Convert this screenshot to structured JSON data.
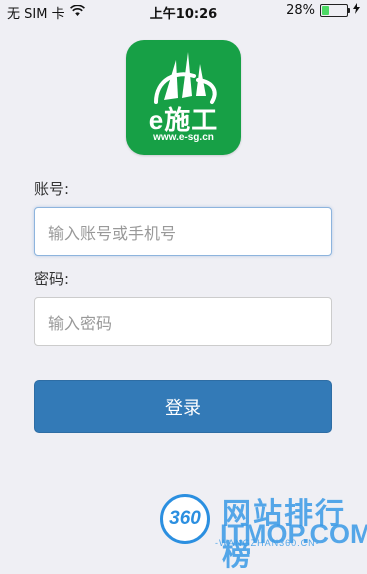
{
  "status_bar": {
    "carrier": "无 SIM 卡",
    "time": "上午10:26",
    "battery_percent_text": "28%",
    "battery_level": 0.28
  },
  "logo": {
    "brand": "e施工",
    "url": "www.e-sg.cn",
    "color": "#17a046"
  },
  "form": {
    "account_label": "账号:",
    "account_placeholder": "输入账号或手机号",
    "password_label": "密码:",
    "password_placeholder": "输入密码",
    "login_button": "登录"
  },
  "watermark": {
    "badge": "360",
    "title": "网站排行榜",
    "domain": "ITMOP.COM",
    "sub": "-WANGZHAN360.CN-"
  },
  "colors": {
    "primary": "#337ab7",
    "background": "#efeff4"
  }
}
